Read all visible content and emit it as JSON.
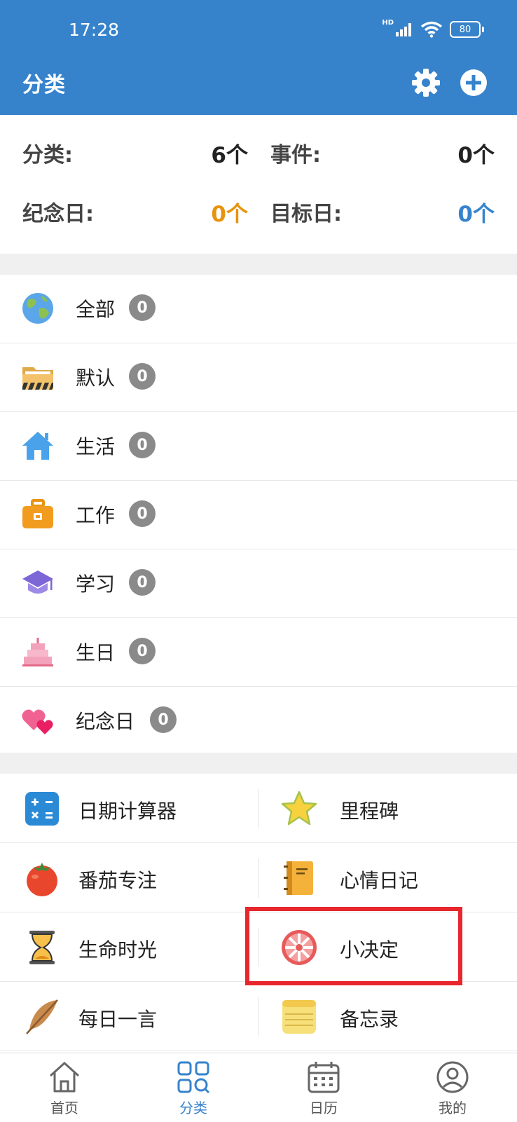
{
  "status_bar": {
    "time": "17:28",
    "network": "HD",
    "battery": "80"
  },
  "header": {
    "title": "分类"
  },
  "stats": {
    "category_label": "分类:",
    "category_value": "6个",
    "event_label": "事件:",
    "event_value": "0个",
    "anniversary_label": "纪念日:",
    "anniversary_value": "0个",
    "target_label": "目标日:",
    "target_value": "0个"
  },
  "categories": [
    {
      "label": "全部",
      "count": "0",
      "icon": "globe-icon"
    },
    {
      "label": "默认",
      "count": "0",
      "icon": "folder-icon"
    },
    {
      "label": "生活",
      "count": "0",
      "icon": "house-icon"
    },
    {
      "label": "工作",
      "count": "0",
      "icon": "briefcase-icon"
    },
    {
      "label": "学习",
      "count": "0",
      "icon": "graduation-cap-icon"
    },
    {
      "label": "生日",
      "count": "0",
      "icon": "cake-icon"
    },
    {
      "label": "纪念日",
      "count": "0",
      "icon": "hearts-icon"
    }
  ],
  "tools": [
    {
      "left": "日期计算器",
      "right": "里程碑"
    },
    {
      "left": "番茄专注",
      "right": "心情日记"
    },
    {
      "left": "生命时光",
      "right": "小决定"
    },
    {
      "left": "每日一言",
      "right": "备忘录"
    }
  ],
  "nav": [
    {
      "label": "首页",
      "icon": "home-icon"
    },
    {
      "label": "分类",
      "icon": "category-grid-icon"
    },
    {
      "label": "日历",
      "icon": "calendar-icon"
    },
    {
      "label": "我的",
      "icon": "profile-icon"
    }
  ],
  "colors": {
    "header": "#3683cc",
    "orange": "#e8930f",
    "blue": "#3683cc",
    "highlight": "#e8262d"
  }
}
